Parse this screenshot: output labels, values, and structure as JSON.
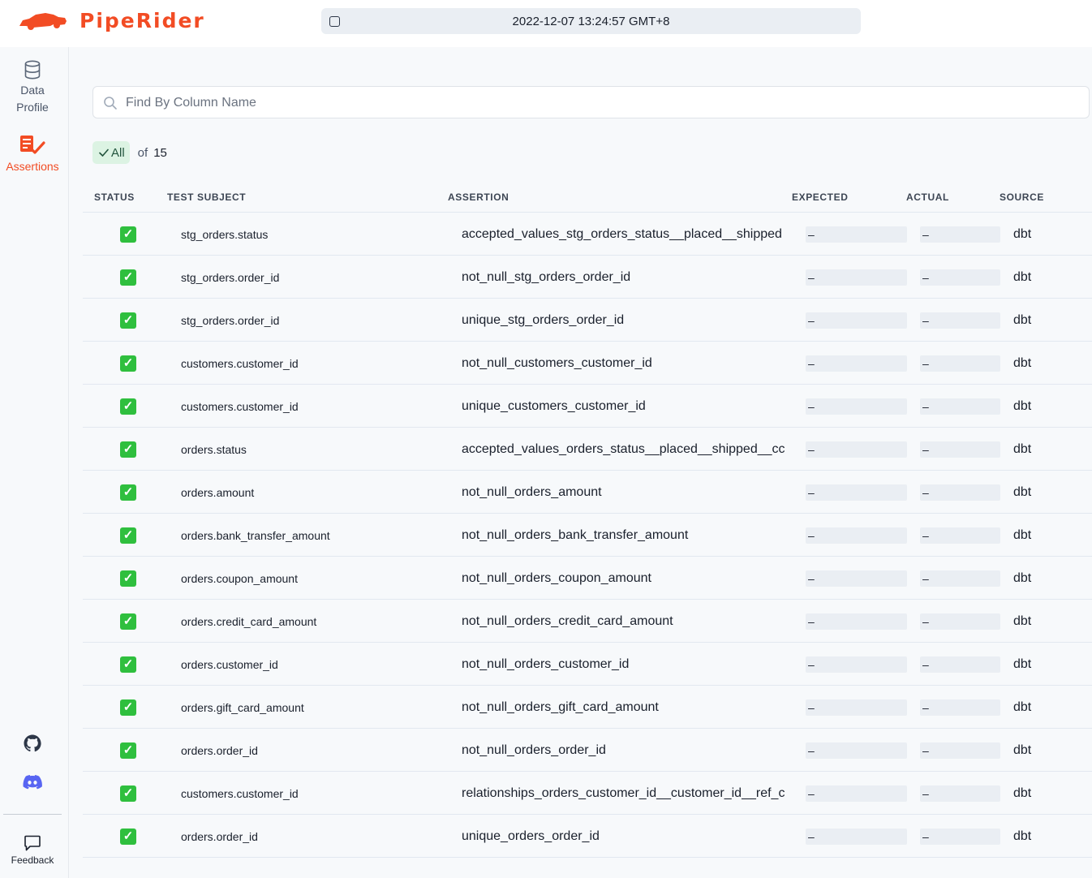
{
  "app": {
    "name": "PipeRider",
    "brand_color": "#f24c24"
  },
  "header": {
    "run_selector": {
      "value": "2022-12-07 13:24:57 GMT+8"
    }
  },
  "sidebar": {
    "items": [
      {
        "label_line1": "Data",
        "label_line2": "Profile",
        "icon": "database-icon",
        "active": false
      },
      {
        "label_line1": "Assertions",
        "icon": "assertions-icon",
        "active": true
      }
    ],
    "links": [
      {
        "icon": "github-icon"
      },
      {
        "icon": "discord-icon"
      }
    ],
    "feedback_label": "Feedback"
  },
  "search": {
    "placeholder": "Find By Column Name",
    "value": ""
  },
  "filter": {
    "chip_label": "All",
    "of_label": "of",
    "total": "15"
  },
  "table": {
    "columns": [
      "STATUS",
      "TEST SUBJECT",
      "ASSERTION",
      "EXPECTED",
      "ACTUAL",
      "SOURCE"
    ],
    "rows": [
      {
        "status": "passed",
        "subject": "stg_orders.status",
        "assertion": "accepted_values_stg_orders_status__placed__shipped",
        "expected": "–",
        "actual": "–",
        "source": "dbt"
      },
      {
        "status": "passed",
        "subject": "stg_orders.order_id",
        "assertion": "not_null_stg_orders_order_id",
        "expected": "–",
        "actual": "–",
        "source": "dbt"
      },
      {
        "status": "passed",
        "subject": "stg_orders.order_id",
        "assertion": "unique_stg_orders_order_id",
        "expected": "–",
        "actual": "–",
        "source": "dbt"
      },
      {
        "status": "passed",
        "subject": "customers.customer_id",
        "assertion": "not_null_customers_customer_id",
        "expected": "–",
        "actual": "–",
        "source": "dbt"
      },
      {
        "status": "passed",
        "subject": "customers.customer_id",
        "assertion": "unique_customers_customer_id",
        "expected": "–",
        "actual": "–",
        "source": "dbt"
      },
      {
        "status": "passed",
        "subject": "orders.status",
        "assertion": "accepted_values_orders_status__placed__shipped__cc",
        "expected": "–",
        "actual": "–",
        "source": "dbt"
      },
      {
        "status": "passed",
        "subject": "orders.amount",
        "assertion": "not_null_orders_amount",
        "expected": "–",
        "actual": "–",
        "source": "dbt"
      },
      {
        "status": "passed",
        "subject": "orders.bank_transfer_amount",
        "assertion": "not_null_orders_bank_transfer_amount",
        "expected": "–",
        "actual": "–",
        "source": "dbt"
      },
      {
        "status": "passed",
        "subject": "orders.coupon_amount",
        "assertion": "not_null_orders_coupon_amount",
        "expected": "–",
        "actual": "–",
        "source": "dbt"
      },
      {
        "status": "passed",
        "subject": "orders.credit_card_amount",
        "assertion": "not_null_orders_credit_card_amount",
        "expected": "–",
        "actual": "–",
        "source": "dbt"
      },
      {
        "status": "passed",
        "subject": "orders.customer_id",
        "assertion": "not_null_orders_customer_id",
        "expected": "–",
        "actual": "–",
        "source": "dbt"
      },
      {
        "status": "passed",
        "subject": "orders.gift_card_amount",
        "assertion": "not_null_orders_gift_card_amount",
        "expected": "–",
        "actual": "–",
        "source": "dbt"
      },
      {
        "status": "passed",
        "subject": "orders.order_id",
        "assertion": "not_null_orders_order_id",
        "expected": "–",
        "actual": "–",
        "source": "dbt"
      },
      {
        "status": "passed",
        "subject": "customers.customer_id",
        "assertion": "relationships_orders_customer_id__customer_id__ref_c",
        "expected": "–",
        "actual": "–",
        "source": "dbt"
      },
      {
        "status": "passed",
        "subject": "orders.order_id",
        "assertion": "unique_orders_order_id",
        "expected": "–",
        "actual": "–",
        "source": "dbt"
      }
    ]
  }
}
